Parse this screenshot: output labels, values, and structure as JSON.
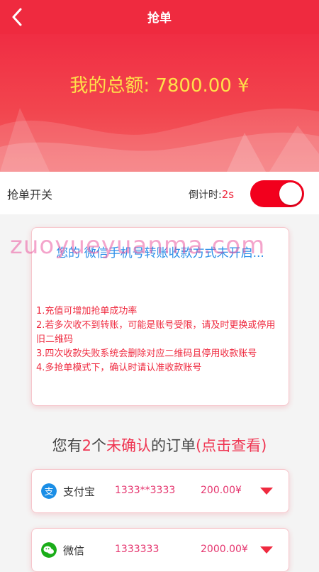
{
  "header": {
    "title": "抢单",
    "back_icon": "chevron-left-icon"
  },
  "hero": {
    "total_text": "我的总额: 7800.00 ¥"
  },
  "switch_row": {
    "label": "抢单开关",
    "countdown_label": "倒计时:",
    "countdown_value": "2s",
    "toggle_on": true
  },
  "notice": {
    "status_text": "您的 微信手机号转账收款方式未开启...",
    "watermark_text": "zuoyueyuanma.com",
    "tips": [
      "1.充值可增加抢单成功率",
      "2.若多次收不到转账，可能是账号受限，请及时更换或停用旧二维码",
      "3.四次收款失败系统会删除对应二维码且停用收款账号",
      "4.多抢单模式下，确认时请认准收款账号"
    ]
  },
  "orders_summary": {
    "prefix": "您有",
    "count": "2",
    "middle": "个",
    "unconfirmed": "未确认",
    "suffix": "的订单",
    "link": "(点击查看)"
  },
  "orders": [
    {
      "icon": "alipay-icon",
      "method": "支付宝",
      "account": "1333**3333",
      "amount": "200.00¥"
    },
    {
      "icon": "wechat-icon",
      "method": "微信",
      "account": "1333333",
      "amount": "2000.00¥"
    }
  ],
  "colors": {
    "primary": "#ef2a3f",
    "total_text": "#ffe04a",
    "status_blue": "#2b8ee8",
    "toggle": "#f2001d",
    "accent_pink": "#e5366f"
  }
}
